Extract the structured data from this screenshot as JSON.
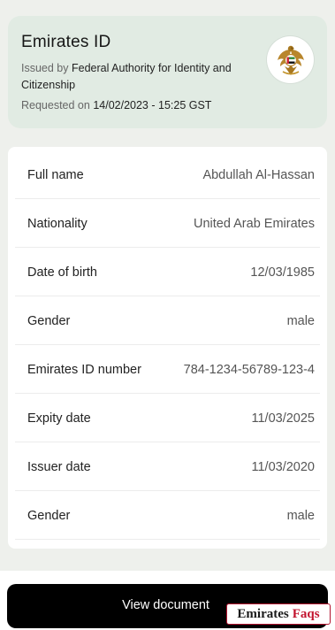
{
  "header": {
    "title": "Emirates ID",
    "issued_prefix": "Issued by",
    "issuer": "Federal Authority for Identity and Citizenship",
    "requested_prefix": "Requested on",
    "requested_datetime": "14/02/2023 - 15:25 GST",
    "emblem_icon": "uae-emblem-icon"
  },
  "details": [
    {
      "label": "Full name",
      "value": "Abdullah Al-Hassan"
    },
    {
      "label": "Nationality",
      "value": "United Arab Emirates"
    },
    {
      "label": "Date of birth",
      "value": "12/03/1985"
    },
    {
      "label": "Gender",
      "value": "male"
    },
    {
      "label": "Emirates ID number",
      "value": "784-1234-56789-123-4"
    },
    {
      "label": "Expity date",
      "value": "11/03/2025"
    },
    {
      "label": "Issuer date",
      "value": "11/03/2020"
    },
    {
      "label": "Gender",
      "value": "male"
    }
  ],
  "actions": {
    "view_document": "View document"
  },
  "watermark": {
    "part1": "Emirates",
    "part2": "Faqs"
  },
  "colors": {
    "page_bg": "#eef0ec",
    "header_card_bg": "#e1ebe3",
    "button_bg": "#000000",
    "watermark_red": "#c3142f"
  }
}
